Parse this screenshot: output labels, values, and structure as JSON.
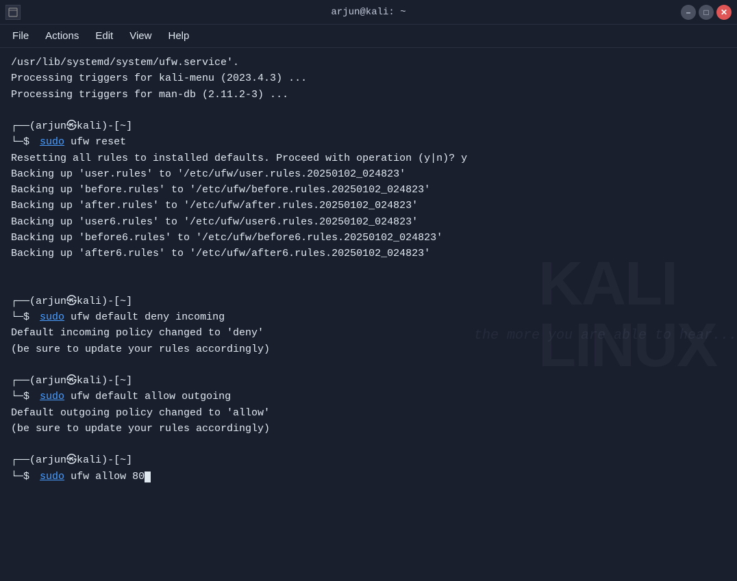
{
  "titlebar": {
    "title": "arjun@kali: ~",
    "icon_label": "terminal-icon"
  },
  "menubar": {
    "items": [
      {
        "label": "File",
        "id": "menu-file"
      },
      {
        "label": "Actions",
        "id": "menu-actions"
      },
      {
        "label": "Edit",
        "id": "menu-edit"
      },
      {
        "label": "View",
        "id": "menu-view"
      },
      {
        "label": "Help",
        "id": "menu-help"
      }
    ]
  },
  "terminal": {
    "lines": [
      {
        "type": "output",
        "text": "/usr/lib/systemd/system/ufw.service'."
      },
      {
        "type": "output",
        "text": "Processing triggers for kali-menu (2023.4.3) ..."
      },
      {
        "type": "output",
        "text": "Processing triggers for man-db (2.11.2-3) ..."
      },
      {
        "type": "empty"
      },
      {
        "type": "prompt",
        "user": "arjun",
        "host": "kali",
        "dir": "~"
      },
      {
        "type": "command",
        "sudo": true,
        "text": "ufw reset"
      },
      {
        "type": "output",
        "text": "Resetting all rules to installed defaults. Proceed with operation (y|n)? y"
      },
      {
        "type": "output",
        "text": "Backing up 'user.rules' to '/etc/ufw/user.rules.20250102_024823'"
      },
      {
        "type": "output",
        "text": "Backing up 'before.rules' to '/etc/ufw/before.rules.20250102_024823'"
      },
      {
        "type": "output",
        "text": "Backing up 'after.rules' to '/etc/ufw/after.rules.20250102_024823'"
      },
      {
        "type": "output",
        "text": "Backing up 'user6.rules' to '/etc/ufw/user6.rules.20250102_024823'"
      },
      {
        "type": "output",
        "text": "Backing up 'before6.rules' to '/etc/ufw/before6.rules.20250102_024823'"
      },
      {
        "type": "output",
        "text": "Backing up 'after6.rules' to '/etc/ufw/after6.rules.20250102_024823'"
      },
      {
        "type": "empty"
      },
      {
        "type": "empty"
      },
      {
        "type": "prompt",
        "user": "arjun",
        "host": "kali",
        "dir": "~"
      },
      {
        "type": "command",
        "sudo": true,
        "text": "ufw default deny incoming"
      },
      {
        "type": "output",
        "text": "Default incoming policy changed to 'deny'"
      },
      {
        "type": "output",
        "text": "(be sure to update your rules accordingly)"
      },
      {
        "type": "empty"
      },
      {
        "type": "prompt",
        "user": "arjun",
        "host": "kali",
        "dir": "~"
      },
      {
        "type": "command",
        "sudo": true,
        "text": "ufw default allow outgoing"
      },
      {
        "type": "output",
        "text": "Default outgoing policy changed to 'allow'"
      },
      {
        "type": "output",
        "text": "(be sure to update your rules accordingly)"
      },
      {
        "type": "empty"
      },
      {
        "type": "prompt",
        "user": "arjun",
        "host": "kali",
        "dir": "~"
      },
      {
        "type": "command_cursor",
        "sudo": true,
        "text": "ufw allow 80"
      }
    ],
    "watermark_line1": "KALI",
    "watermark_line2": "LINUX",
    "watermark_italic": "the more you are able to hear..."
  }
}
